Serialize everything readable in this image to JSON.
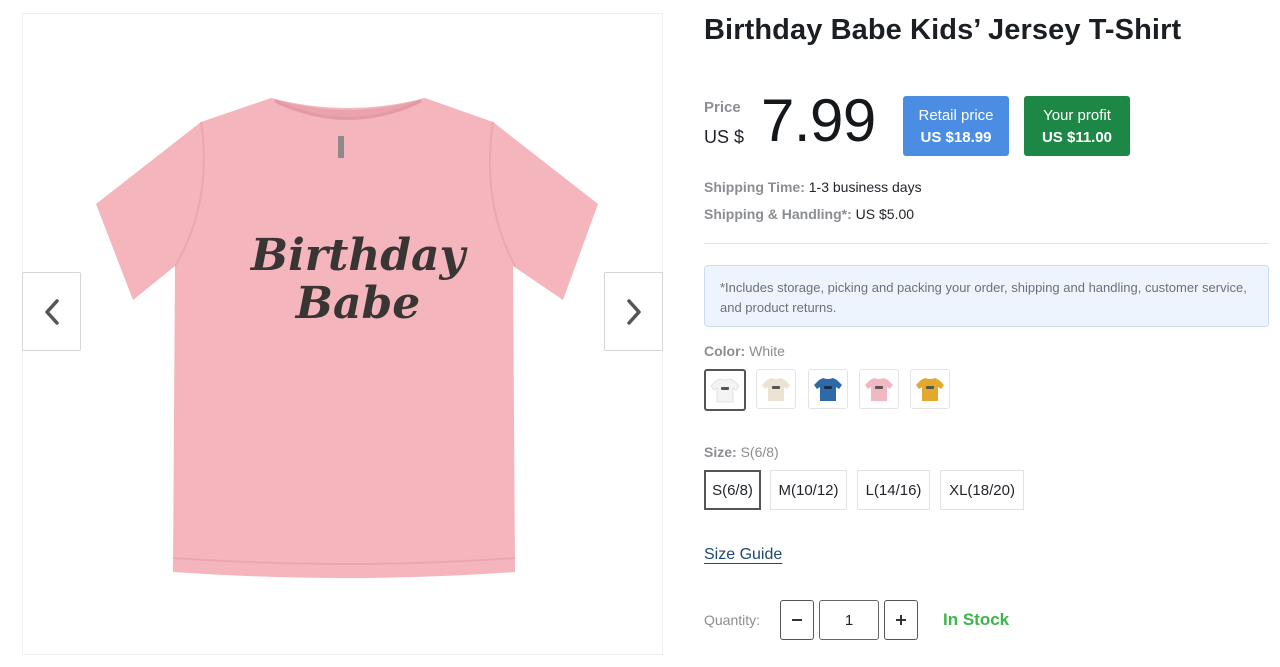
{
  "product": {
    "title": "Birthday Babe Kids’ Jersey T-Shirt",
    "image_print_line1": "Birthday",
    "image_print_line2": "Babe"
  },
  "gallery": {
    "prev_icon": "chevron-left-icon",
    "next_icon": "chevron-right-icon"
  },
  "price": {
    "label": "Price",
    "currency": "US $",
    "value": "7.99"
  },
  "retail": {
    "label": "Retail price",
    "amount": "US $18.99",
    "color": "#4a8de3"
  },
  "profit": {
    "label": "Your profit",
    "amount": "US $11.00",
    "color": "#1d8845"
  },
  "shipping": {
    "time_label": "Shipping Time:",
    "time_value": "1-3 business days",
    "handling_label": "Shipping & Handling*:",
    "handling_value": "US $5.00"
  },
  "notice": "*Includes storage, picking and packing your order, shipping and handling, customer service, and product returns.",
  "color": {
    "label": "Color:",
    "selected": "White",
    "swatches": [
      {
        "name": "White",
        "hex": "#f4f4f4"
      },
      {
        "name": "Natural",
        "hex": "#ece3d2"
      },
      {
        "name": "Blue",
        "hex": "#2f6aa8"
      },
      {
        "name": "Pink",
        "hex": "#f2b8c2"
      },
      {
        "name": "Mustard",
        "hex": "#e3a82e"
      }
    ]
  },
  "size": {
    "label": "Size:",
    "selected": "S(6/8)",
    "options": [
      "S(6/8)",
      "M(10/12)",
      "L(14/16)",
      "XL(18/20)"
    ]
  },
  "size_guide": "Size Guide",
  "quantity": {
    "label": "Quantity:",
    "value": "1",
    "minus_icon": "minus-icon",
    "plus_icon": "plus-icon"
  },
  "stock_status": "In Stock",
  "colors": {
    "shirt_pink": "#f4b5bd",
    "print": "#3a3535",
    "in_stock": "#3cb54a"
  }
}
